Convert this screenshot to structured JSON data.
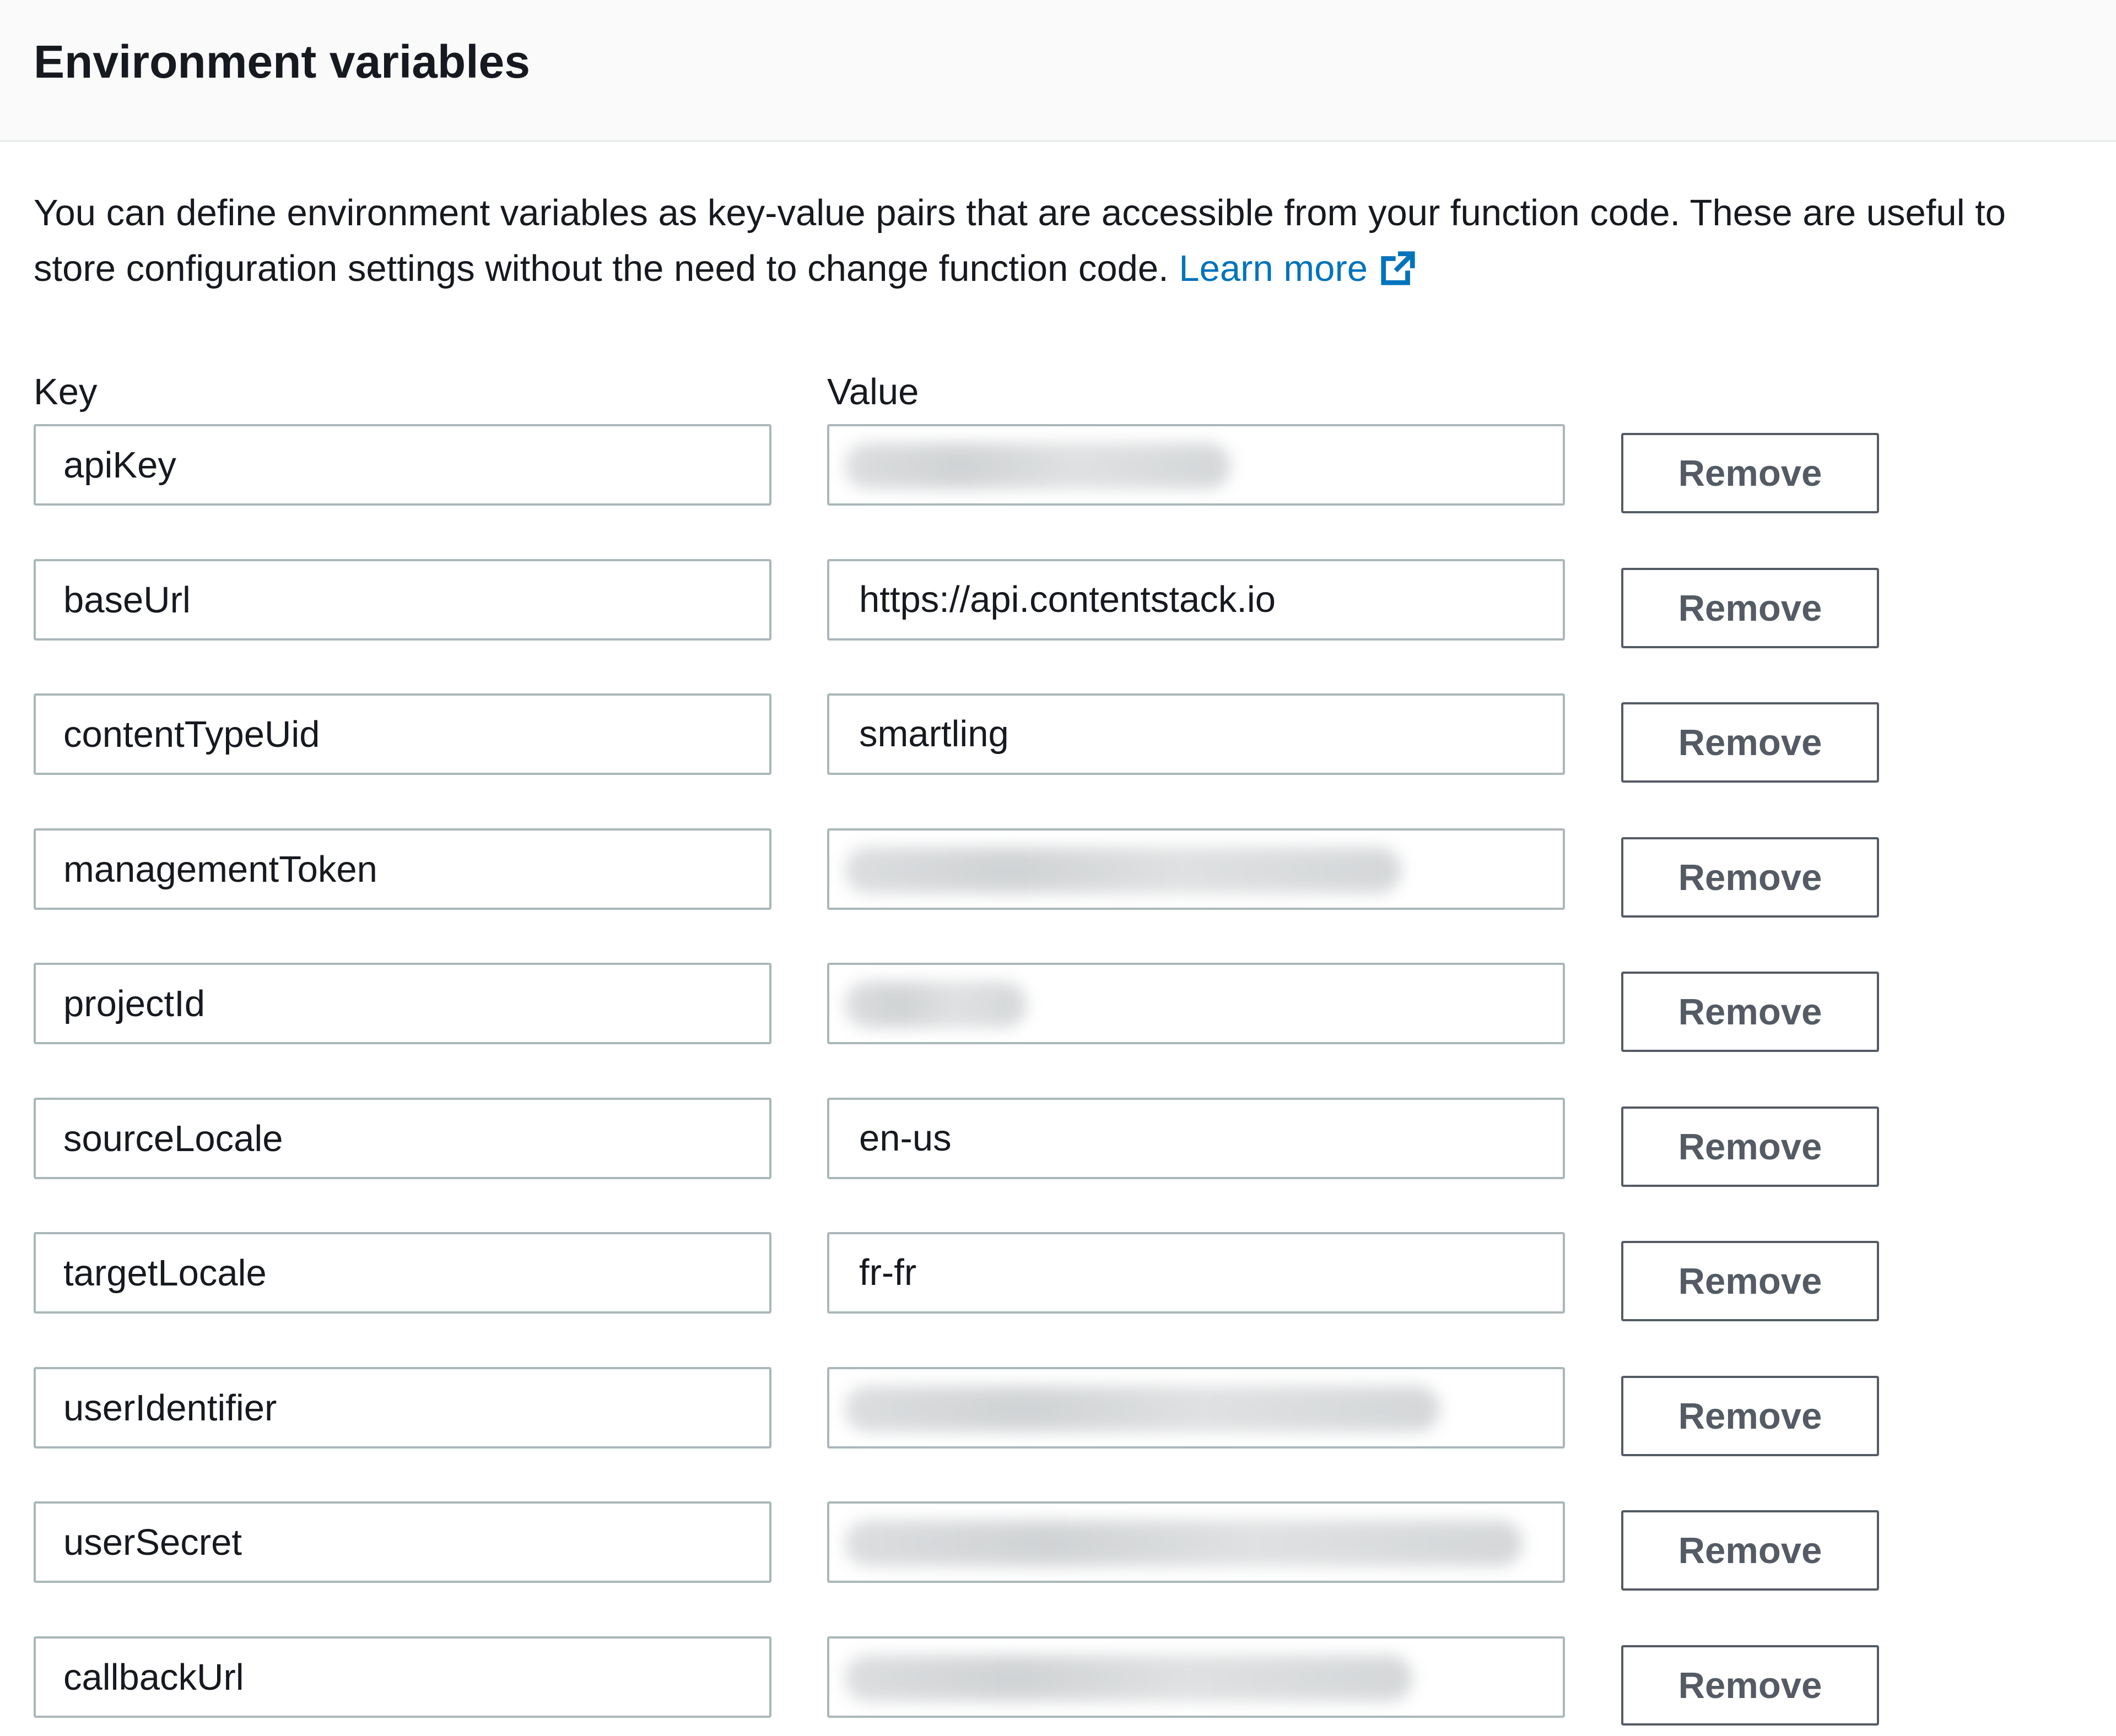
{
  "header": {
    "title": "Environment variables"
  },
  "description": {
    "text": "You can define environment variables as key-value pairs that are accessible from your function code. These are useful to store configuration settings without the need to change function code.",
    "link_label": "Learn more",
    "link_icon": "external-link-icon"
  },
  "columns": {
    "key_label": "Key",
    "value_label": "Value"
  },
  "colors": {
    "link": "#0073bb",
    "border": "#aab7b8",
    "button": "#545b64"
  },
  "variables": [
    {
      "key": "apiKey",
      "value": "",
      "value_redacted": true,
      "remove_label": "Remove"
    },
    {
      "key": "baseUrl",
      "value": "https://api.contentstack.io",
      "value_redacted": false,
      "remove_label": "Remove"
    },
    {
      "key": "contentTypeUid",
      "value": "smartling",
      "value_redacted": false,
      "remove_label": "Remove"
    },
    {
      "key": "managementToken",
      "value": "",
      "value_redacted": true,
      "remove_label": "Remove"
    },
    {
      "key": "projectId",
      "value": "",
      "value_redacted": true,
      "remove_label": "Remove"
    },
    {
      "key": "sourceLocale",
      "value": "en-us",
      "value_redacted": false,
      "remove_label": "Remove"
    },
    {
      "key": "targetLocale",
      "value": "fr-fr",
      "value_redacted": false,
      "remove_label": "Remove"
    },
    {
      "key": "userIdentifier",
      "value": "",
      "value_redacted": true,
      "remove_label": "Remove"
    },
    {
      "key": "userSecret",
      "value": "",
      "value_redacted": true,
      "remove_label": "Remove"
    },
    {
      "key": "callbackUrl",
      "value": "",
      "value_redacted": true,
      "remove_label": "Remove"
    }
  ]
}
